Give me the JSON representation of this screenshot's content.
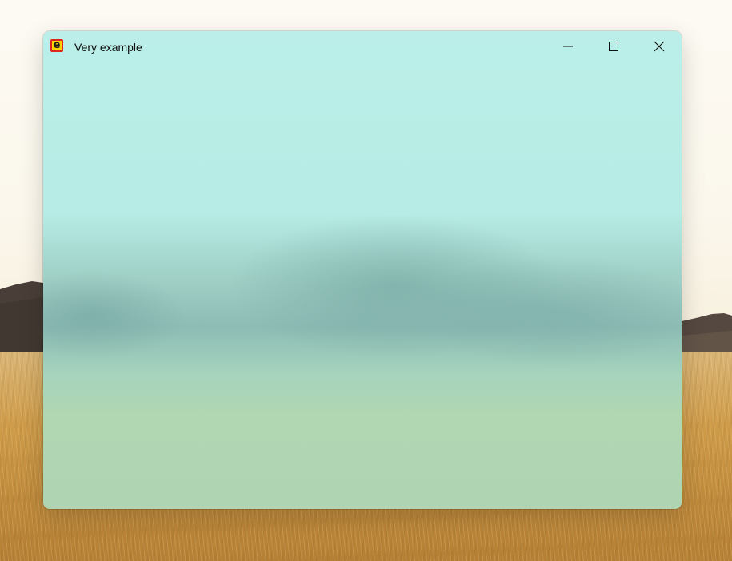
{
  "window": {
    "title": "Very example",
    "app_icon": {
      "name": "app-icon",
      "glyph": "e"
    }
  },
  "titlebar": {
    "buttons": [
      {
        "id": "minimize",
        "icon": "minimize-icon"
      },
      {
        "id": "maximize",
        "icon": "maximize-icon"
      },
      {
        "id": "close",
        "icon": "close-icon"
      }
    ]
  },
  "colors": {
    "icon_fill": "#ffd400",
    "icon_border": "#e0261c",
    "window_tint_top": "#bbeee8",
    "window_tint_bottom": "#afd4b2"
  }
}
